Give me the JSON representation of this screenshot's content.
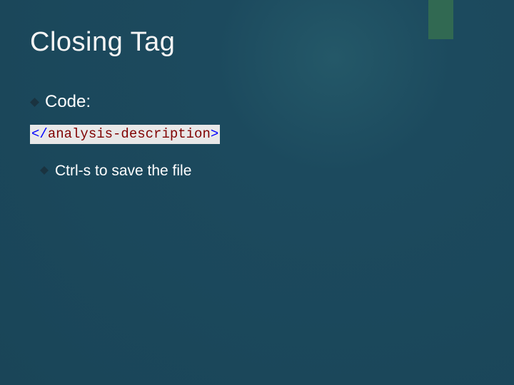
{
  "title": "Closing Tag",
  "bullets": {
    "item1": "Code:",
    "item2": "Ctrl-s to save the file"
  },
  "code": {
    "bracket_open": "</",
    "tag_name": "analysis-description",
    "bracket_close": ">"
  }
}
